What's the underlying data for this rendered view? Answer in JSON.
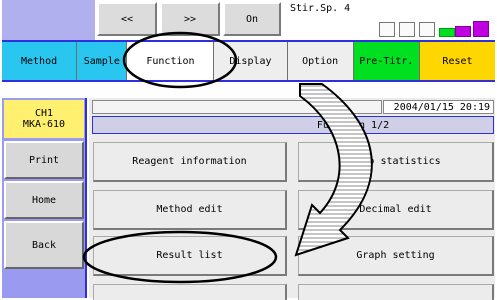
{
  "top_controls": {
    "prev_label": "<<",
    "next_label": ">>",
    "on_label": "On",
    "stir_label": "Stir.Sp. 4"
  },
  "tabs": [
    {
      "label": "Method",
      "color": "#29c7ef"
    },
    {
      "label": "Sample",
      "color": "#29c7ef"
    },
    {
      "label": "Function",
      "color": "#ffffff"
    },
    {
      "label": "Display",
      "color": "#eeeeee"
    },
    {
      "label": "Option",
      "color": "#eeeeee"
    },
    {
      "label": "Pre-Titr.",
      "color": "#00e020"
    },
    {
      "label": "Reset",
      "color": "#ffd700"
    }
  ],
  "sidebar": {
    "channel_line1": "CH1",
    "channel_line2": "MKA-610",
    "items": [
      {
        "label": "Print"
      },
      {
        "label": "Home"
      },
      {
        "label": "Back"
      }
    ]
  },
  "header": {
    "datetime": "2004/01/15 20:19",
    "page_title": "Function 1/2"
  },
  "function_buttons": [
    {
      "label": "Reagent information"
    },
    {
      "label": "Auto statistics"
    },
    {
      "label": "Method edit"
    },
    {
      "label": "Decimal edit"
    },
    {
      "label": "Result list"
    },
    {
      "label": "Graph setting"
    }
  ],
  "colors": {
    "accent_blue": "#2f2fe0",
    "sidebar_bg": "#9a9af0",
    "title_bar": "#cfcfe8",
    "channel_bg": "#fff070",
    "lamp_green": "#00e020",
    "lamp_magenta": "#c000e0"
  }
}
